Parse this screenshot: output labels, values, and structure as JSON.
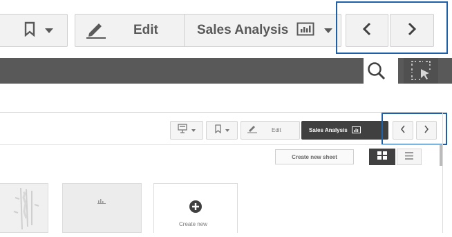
{
  "toolbar_zoomed": {
    "bookmark_icon": "bookmark-icon",
    "edit_icon": "pencil-icon",
    "edit_label": "Edit",
    "sheet_name": "Sales Analysis",
    "sheet_icon": "sheet-chart-icon",
    "prev_icon": "chevron-left-icon",
    "next_icon": "chevron-right-icon",
    "prev_glyph": "<",
    "next_glyph": ">"
  },
  "dark_bar": {
    "search_icon": "search-icon",
    "selection_icon": "selection-mode-icon"
  },
  "toolbar_small": {
    "edit_label": "Edit",
    "sheet_name": "Sales Analysis",
    "prev_glyph": "<",
    "next_glyph": ">",
    "create_sheet_label": "Create new sheet"
  },
  "sheets_area": {
    "create_card_label": "Create new"
  },
  "colors": {
    "highlight": "#1f5fa8",
    "dark_bar": "#595959",
    "sheet_active_bg": "#404040"
  }
}
